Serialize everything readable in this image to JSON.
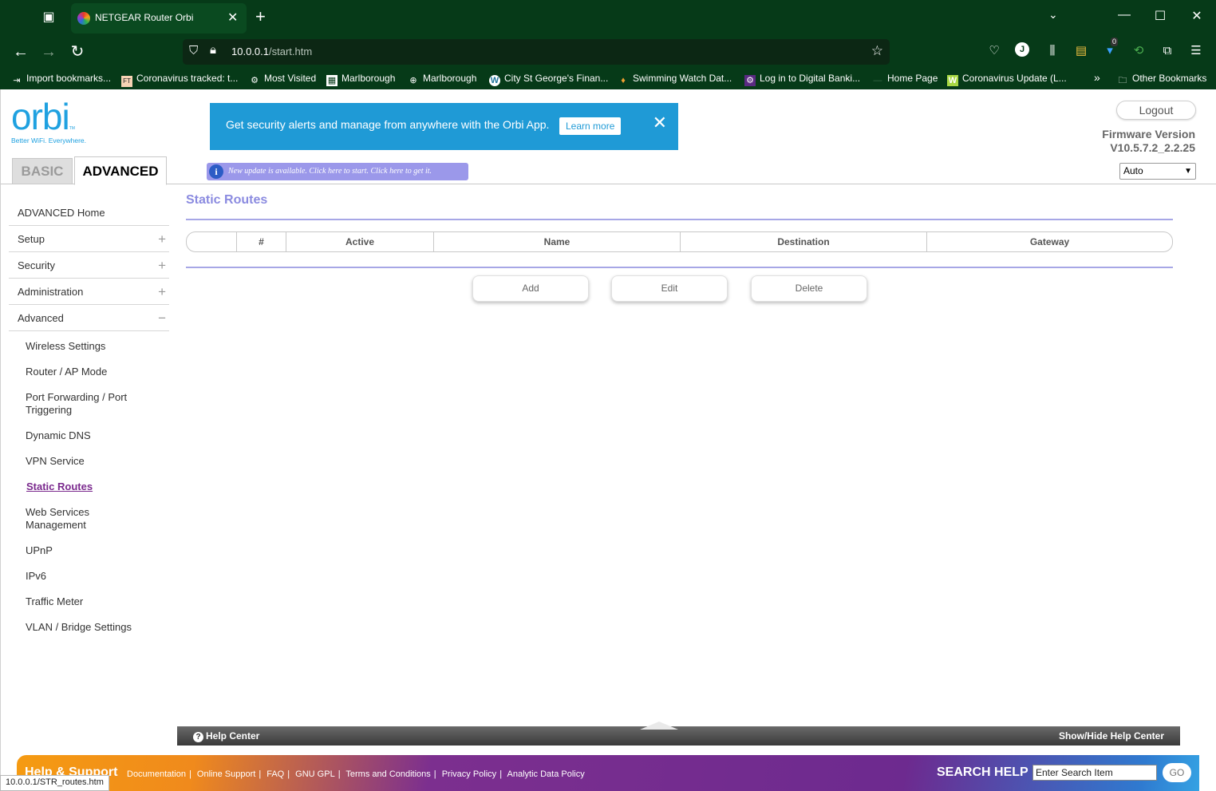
{
  "browser": {
    "tab_title": "NETGEAR Router Orbi",
    "tab_close": "✕",
    "new_tab": "+",
    "url_host": "10.0.0.1",
    "url_path": "/start.htm",
    "extension_badge": "0",
    "profile_initial": "J",
    "bookmarks": [
      {
        "label": "Import bookmarks...",
        "icon": "⇥"
      },
      {
        "label": "Coronavirus tracked: t...",
        "icon": "FT"
      },
      {
        "label": "Most Visited",
        "icon": "⚙"
      },
      {
        "label": "Marlborough",
        "icon": "▦"
      },
      {
        "label": "Marlborough",
        "icon": "⊕"
      },
      {
        "label": "City St George's Finan...",
        "icon": "W"
      },
      {
        "label": "Swimming Watch Dat...",
        "icon": "♦"
      },
      {
        "label": "Log in to Digital Banki...",
        "icon": "⚙"
      },
      {
        "label": "Home Page",
        "icon": "—"
      },
      {
        "label": "Coronavirus Update (L...",
        "icon": "W"
      }
    ],
    "other_bookmarks": "Other Bookmarks",
    "status_url": "10.0.0.1/STR_routes.htm"
  },
  "header": {
    "logo_text": "orbi",
    "logo_tm": "TM",
    "logo_tagline": "Better WiFi. Everywhere.",
    "tab_basic": "BASIC",
    "tab_advanced": "ADVANCED",
    "banner_message": "Get security alerts and manage from anywhere with the Orbi App.",
    "banner_learn_more": "Learn more",
    "banner_close": "✕",
    "update_notice": "New update is available. Click here to start. Click here to get it.",
    "update_icon": "i",
    "logout": "Logout",
    "firmware_label": "Firmware Version",
    "firmware_value": "V10.5.7.2_2.2.25",
    "language": "Auto"
  },
  "sidebar": {
    "main": [
      {
        "label": "ADVANCED Home",
        "sign": ""
      },
      {
        "label": "Setup",
        "sign": "+"
      },
      {
        "label": "Security",
        "sign": "+"
      },
      {
        "label": "Administration",
        "sign": "+"
      },
      {
        "label": "Advanced",
        "sign": "−"
      }
    ],
    "sub": [
      "Wireless Settings",
      "Router / AP Mode",
      "Port Forwarding / Port Triggering",
      "Dynamic DNS",
      "VPN Service",
      "Static Routes",
      "Web Services Management",
      "UPnP",
      "IPv6",
      "Traffic Meter",
      "VLAN / Bridge Settings"
    ],
    "active_sub": "Static Routes"
  },
  "content": {
    "title": "Static Routes",
    "table_headers": [
      "",
      "#",
      "Active",
      "Name",
      "Destination",
      "Gateway"
    ],
    "buttons": {
      "add": "Add",
      "edit": "Edit",
      "delete": "Delete"
    }
  },
  "help_bar": {
    "help_center": "Help Center",
    "show_hide": "Show/Hide Help Center"
  },
  "footer": {
    "help_support": "Help & Support",
    "links": [
      "Documentation",
      "Online Support",
      "FAQ",
      "GNU GPL",
      "Terms and Conditions",
      "Privacy Policy",
      "Analytic Data Policy"
    ],
    "search_help": "SEARCH HELP",
    "search_value": "Enter Search Item",
    "go": "GO"
  }
}
